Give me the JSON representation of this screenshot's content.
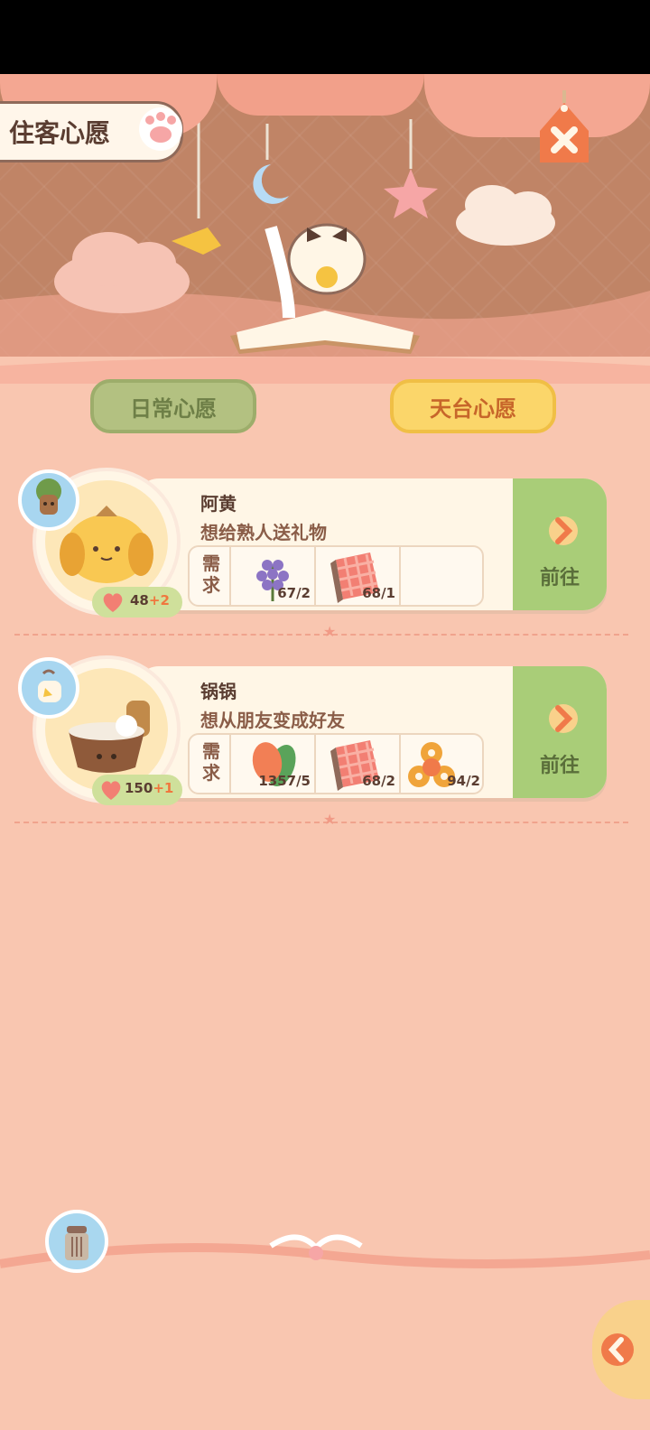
{
  "header": {
    "title": "住客心愿",
    "close_icon": "close-icon"
  },
  "tabs": [
    {
      "label": "日常心愿",
      "active": false
    },
    {
      "label": "天台心愿",
      "active": true
    }
  ],
  "wishes": [
    {
      "name": "阿黄",
      "wish": "想给熟人送礼物",
      "req_label": "需求",
      "requirements": [
        {
          "icon": "lavender-icon",
          "count": "67/2"
        },
        {
          "icon": "gingham-cloth-icon",
          "count": "68/1"
        }
      ],
      "hearts": "48",
      "hearts_bonus": "+2",
      "goto_label": "前往",
      "badge_icon": "tree-stump-icon",
      "avatar_icon": "dog-avatar-icon"
    },
    {
      "name": "锅锅",
      "wish": "想从朋友变成好友",
      "req_label": "需求",
      "requirements": [
        {
          "icon": "tulip-icon",
          "count": "1357/5"
        },
        {
          "icon": "gingham-cloth-icon",
          "count": "68/2"
        },
        {
          "icon": "fidget-spinner-icon",
          "count": "94/2"
        }
      ],
      "hearts": "150",
      "hearts_bonus": "+1",
      "goto_label": "前往",
      "badge_icon": "chick-icon",
      "avatar_icon": "pot-avatar-icon"
    }
  ],
  "colors": {
    "background": "#f9c6b0",
    "card": "#fff6e6",
    "goto": "#a9cd78",
    "tab_active": "#fbd66a",
    "tab_inactive": "#b3c181"
  }
}
